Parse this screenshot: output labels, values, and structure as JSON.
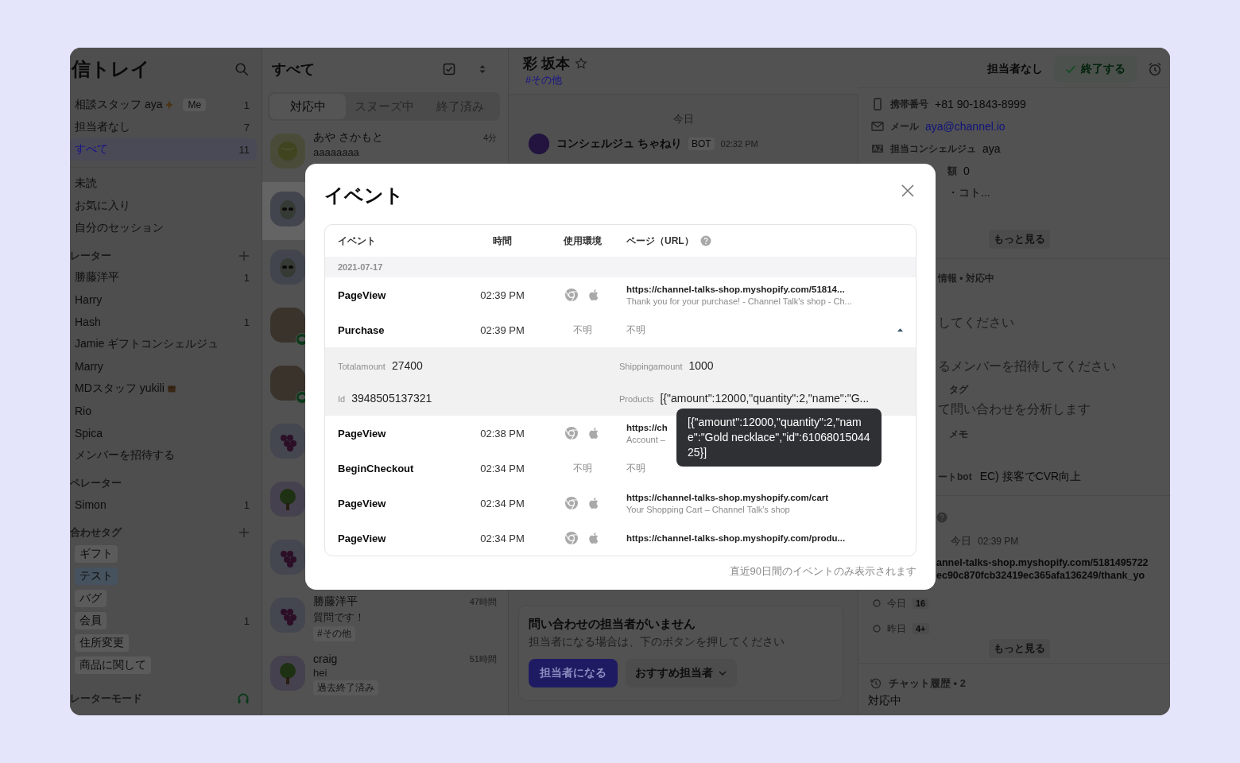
{
  "sidebar": {
    "title": "信トレイ",
    "top_items": [
      {
        "label": "相談スタッフ aya",
        "kind": "sparkle",
        "badge": "Me",
        "count": "1",
        "selected": false
      },
      {
        "label": "担当者なし",
        "count": "7",
        "selected": false
      },
      {
        "label": "すべて",
        "count": "11",
        "selected": true
      }
    ],
    "views": [
      {
        "label": "未読",
        "selected": false
      },
      {
        "label": "お気に入り",
        "selected": false
      },
      {
        "label": "自分のセッション",
        "selected": false
      }
    ],
    "groups": [
      {
        "title": "レーター",
        "addable": true,
        "items": [
          {
            "label": "勝藤洋平",
            "count": "1",
            "selected": false
          },
          {
            "label": "Harry",
            "selected": false
          },
          {
            "label": "Hash",
            "count": "1",
            "selected": false
          },
          {
            "label": "Jamie ギフトコンシェルジュ",
            "selected": false
          },
          {
            "label": "Marry",
            "selected": false
          },
          {
            "label": "MDスタッフ yukili",
            "kind": "box",
            "selected": false
          },
          {
            "label": "Rio",
            "selected": false
          },
          {
            "label": "Spica",
            "selected": false
          },
          {
            "label": "メンバーを招待する",
            "selected": false
          }
        ]
      },
      {
        "title": "ペレーター",
        "addable": false,
        "items": [
          {
            "label": "Simon",
            "count": "1",
            "selected": false
          }
        ]
      }
    ],
    "tags_title": "合わせタグ",
    "tags_addable": true,
    "tags": [
      {
        "label": "ギフト",
        "color": "#5b5b5b"
      },
      {
        "label": "テスト",
        "color": "#46525e"
      },
      {
        "label": "バグ",
        "color": "#5b5b5b"
      },
      {
        "label": "会員",
        "color": "#5b5b5b",
        "count": "1"
      },
      {
        "label": "住所変更",
        "color": "#5b5b5b"
      },
      {
        "label": "商品に関して",
        "color": "#5b5b5b"
      }
    ],
    "footer": "レーターモード"
  },
  "inbox": {
    "title": "すべて",
    "tabs": [
      {
        "label": "対応中",
        "selected": true
      },
      {
        "label": "スヌーズ中",
        "selected": false
      },
      {
        "label": "終了済み",
        "selected": false
      }
    ],
    "conversations": [
      {
        "kind": "melon",
        "line": false,
        "selected": false,
        "name": "あや さかもと",
        "time": "4分",
        "preview": "aaaaaaaa"
      },
      {
        "kind": "alien",
        "line": false,
        "selected": true
      },
      {
        "kind": "alien",
        "line": false,
        "selected": false
      },
      {
        "kind": "photo",
        "line": true,
        "selected": false
      },
      {
        "kind": "photo",
        "line": true,
        "selected": false
      },
      {
        "kind": "grapes",
        "line": false,
        "selected": false
      },
      {
        "kind": "tree",
        "line": false,
        "selected": false
      },
      {
        "kind": "grapes",
        "line": false,
        "selected": false
      },
      {
        "kind": "grapes",
        "line": false,
        "selected": false,
        "name": "勝藤洋平",
        "time": "47時間",
        "preview": "質問です！",
        "tag": "#その他"
      },
      {
        "kind": "tree",
        "line": false,
        "selected": false,
        "name": "craig",
        "time": "51時間",
        "preview": "hei",
        "tag": "過去終了済み"
      }
    ]
  },
  "chat": {
    "name": "彩 坂本",
    "starred": false,
    "tag": "#その他",
    "date": "今日",
    "message": {
      "sender": "コンシェルジュ ちゃねり",
      "badge": "BOT",
      "time": "02:32 PM"
    },
    "assign_card": {
      "title": "問い合わせの担当者がいません",
      "text": "担当者になる場合は、下のボタンを押してください",
      "primary": "担当者になる",
      "secondary": "おすすめ担当者"
    }
  },
  "profile": {
    "assignee": "担当者なし",
    "close_button": "終了する",
    "fields": [
      {
        "kind": "phone",
        "label": "携帯番号",
        "value": "+81 90-1843-8999"
      },
      {
        "kind": "mail",
        "label": "メール",
        "value": "aya@channel.io"
      },
      {
        "kind": "az",
        "label": "担当コンシェルジュ",
        "value": "aya"
      },
      {
        "kind": "none",
        "label": "額",
        "value": "0"
      },
      {
        "kind": "none",
        "value": "・コト..."
      }
    ],
    "more": "もっと見る",
    "info_title": "情報 • 対応中",
    "info_lines": [
      {
        "kind": "hint",
        "text": "してください"
      },
      {
        "kind": "hint",
        "text": "るメンバーを招待してください"
      },
      {
        "kind": "field",
        "label": "タグ",
        "text": "て問い合わせを分析します"
      },
      {
        "kind": "label",
        "text": "メモ"
      },
      {
        "kind": "pair",
        "label": "ートbot",
        "text": "EC) 接客でCVR向上"
      }
    ],
    "latest": {
      "date": "今日",
      "time": "02:39 PM",
      "url_lines": [
        "annel-talks-shop.myshopify.com/5181495722",
        "ec90c870fcb32419ec365afa136249/thank_yo"
      ]
    },
    "visits": [
      {
        "label": "今日",
        "count": "16"
      },
      {
        "label": "昨日",
        "count": "4+"
      }
    ],
    "more_2": "もっと見る",
    "history_title": "チャット履歴 • 2",
    "history_status": "対応中"
  },
  "modal": {
    "title": "イベント",
    "columns": [
      "イベント",
      "時間",
      "使用環境",
      "ページ（URL）"
    ],
    "date": "2021-07-17",
    "events": [
      {
        "name": "PageView",
        "time": "02:39 PM",
        "kind": "icons",
        "url": "https://channel-talks-shop.myshopify.com/51814...",
        "page_title": "Thank you for your purchase! - Channel Talk's shop - Ch...",
        "expanded": false
      },
      {
        "name": "Purchase",
        "time": "02:39 PM",
        "kind": "text",
        "env_text": "不明",
        "page_text": "不明",
        "expanded": true,
        "details": [
          {
            "label": "Totalamount",
            "value": "27400"
          },
          {
            "label": "Shippingamount",
            "value": "1000"
          },
          {
            "label": "Id",
            "value": "3948505137321"
          },
          {
            "label": "Products",
            "value": "[{\"amount\":12000,\"quantity\":2,\"name\":\"G..."
          }
        ],
        "tooltip": "[{\"amount\":12000,\"quantity\":2,\"name\":\"Gold necklace\",\"id\":6106801504425}]"
      },
      {
        "name": "PageView",
        "time": "02:38 PM",
        "kind": "icons",
        "url": "https://ch",
        "page_title": "Account –",
        "expanded": false
      },
      {
        "name": "BeginCheckout",
        "time": "02:34 PM",
        "kind": "text",
        "env_text": "不明",
        "page_text": "不明",
        "expanded": false
      },
      {
        "name": "PageView",
        "time": "02:34 PM",
        "kind": "icons",
        "url": "https://channel-talks-shop.myshopify.com/cart",
        "page_title": "Your Shopping Cart – Channel Talk's shop",
        "expanded": false
      },
      {
        "name": "PageView",
        "time": "02:34 PM",
        "kind": "icons",
        "url": "https://channel-talks-shop.myshopify.com/produ...",
        "expanded": false
      }
    ],
    "note": "直近90日間のイベントのみ表示されます"
  }
}
